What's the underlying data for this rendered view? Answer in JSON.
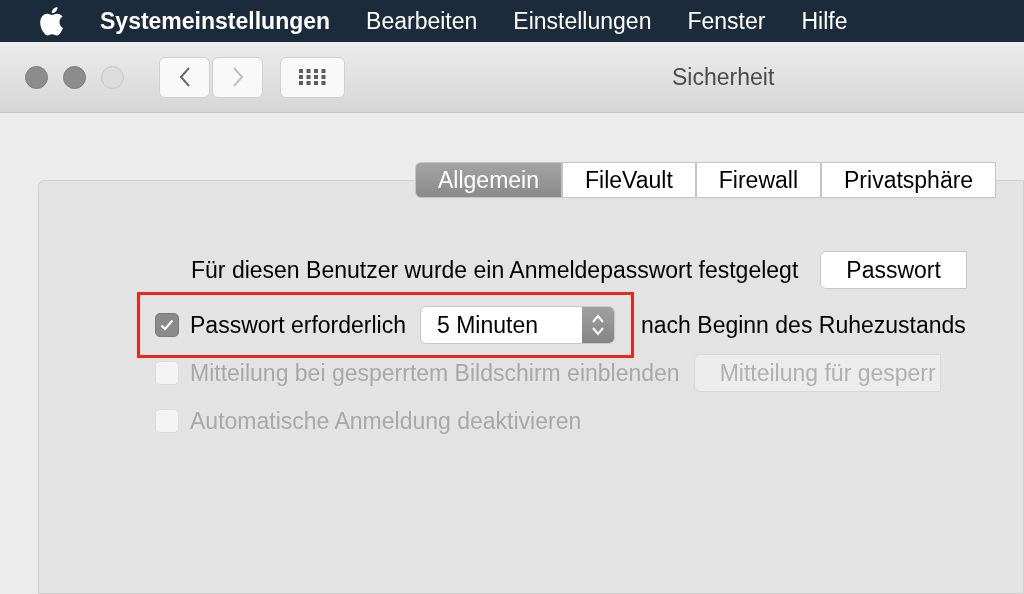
{
  "menu_bar": {
    "items": [
      {
        "label": "Systemeinstellungen",
        "kind": "app"
      },
      {
        "label": "Bearbeiten",
        "kind": "menu"
      },
      {
        "label": "Einstellungen",
        "kind": "menu"
      },
      {
        "label": "Fenster",
        "kind": "menu"
      },
      {
        "label": "Hilfe",
        "kind": "menu"
      }
    ]
  },
  "toolbar": {
    "title": "Sicherheit",
    "window_buttons": [
      {
        "disabled": false
      },
      {
        "disabled": false
      },
      {
        "disabled": true
      }
    ],
    "nav_buttons": [
      {
        "kind": "back",
        "disabled": false
      },
      {
        "kind": "forward",
        "disabled": true
      }
    ]
  },
  "tabs": [
    {
      "label": "Allgemein",
      "selected": true
    },
    {
      "label": "FileVault",
      "selected": false
    },
    {
      "label": "Firewall",
      "selected": false
    },
    {
      "label": "Privatsphäre",
      "selected": false
    }
  ],
  "rows": [
    {
      "kind": "text",
      "label": "Für diesen Benutzer wurde ein Anmeldepasswort festgelegt",
      "button": "Passwort"
    },
    {
      "kind": "select",
      "label": "Passwort erforderlich",
      "checked": true,
      "disabled": false,
      "highlighted": true,
      "value": "5 Minuten",
      "suffix": "nach Beginn des Ruhezustands"
    },
    {
      "kind": "field",
      "label": "Mitteilung bei gesperrtem Bildschirm einblenden",
      "checked": false,
      "disabled": true,
      "field": "Mitteilung für gesperr"
    },
    {
      "kind": "checkbox",
      "label": "Automatische Anmeldung deaktivieren",
      "checked": false,
      "disabled": true
    }
  ]
}
